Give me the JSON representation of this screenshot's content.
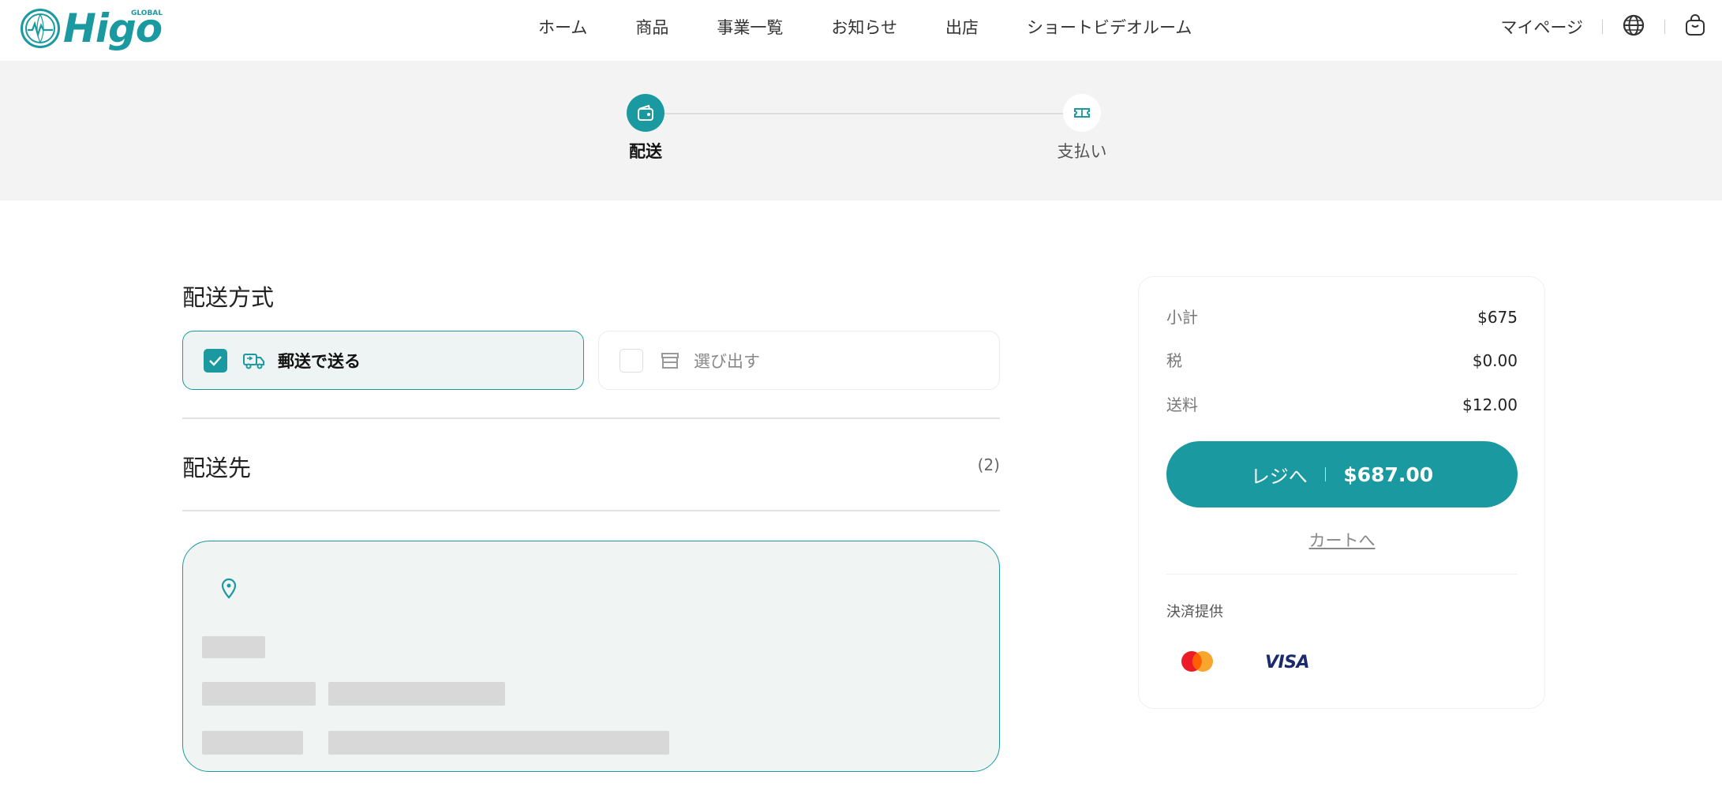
{
  "header": {
    "logo_text": "Higo",
    "logo_sub": "GLOBAL",
    "nav": [
      "ホーム",
      "商品",
      "事業一覧",
      "お知らせ",
      "出店",
      "ショートビデオルーム"
    ],
    "mypage": "マイページ",
    "icons": [
      "globe-icon",
      "shopping-bag-icon"
    ]
  },
  "stepper": {
    "steps": [
      {
        "label": "配送",
        "state": "active",
        "icon": "wallet-icon"
      },
      {
        "label": "支払い",
        "state": "inactive",
        "icon": "ticket-icon"
      }
    ]
  },
  "shipping_method": {
    "title": "配送方式",
    "options": [
      {
        "label": "郵送で送る",
        "checked": true,
        "icon": "truck-icon"
      },
      {
        "label": "選び出す",
        "checked": false,
        "icon": "store-icon"
      }
    ]
  },
  "destination": {
    "title": "配送先",
    "count": "(2)"
  },
  "summary": {
    "subtotal_label": "小計",
    "subtotal": "$675",
    "tax_label": "税",
    "tax": "$0.00",
    "shipping_label": "送料",
    "shipping": "$12.00",
    "checkout_label": "レジへ",
    "total": "$687.00",
    "cart_link": "カートへ",
    "provider_label": "決済提供",
    "providers": [
      "mastercard",
      "VISA"
    ]
  },
  "colors": {
    "accent": "#1a9aa0",
    "band": "#f3f3f3",
    "card_bg": "#f0f4f3"
  }
}
